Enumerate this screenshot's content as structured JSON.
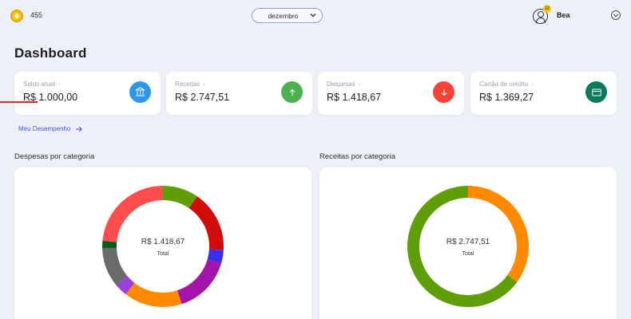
{
  "header": {
    "coins": "455",
    "month": "dezembro",
    "user_badge": "12",
    "user_name": "Bea"
  },
  "page_title": "Dashboard",
  "cards": [
    {
      "label": "Saldo atual",
      "value": "R$ 1.000,00",
      "icon": "bank-icon",
      "color": "#2f96e8"
    },
    {
      "label": "Receitas",
      "value": "R$ 2.747,51",
      "icon": "arrow-up-icon",
      "color": "#4caf50"
    },
    {
      "label": "Despesas",
      "value": "R$ 1.418,67",
      "icon": "arrow-down-icon",
      "color": "#f44336"
    },
    {
      "label": "Cartão de crédito",
      "value": "R$ 1.369,27",
      "icon": "credit-card-icon",
      "color": "#0b7a5c"
    }
  ],
  "performance_link": "Meu Desempenho",
  "expenses_chart": {
    "title": "Despesas por categoria",
    "total": "R$ 1.418,67",
    "total_label": "Total",
    "chart_data": {
      "type": "pie",
      "slices": [
        {
          "value": 9.5,
          "color": "#5f9e09"
        },
        {
          "value": 16.5,
          "color": "#d10a0a"
        },
        {
          "value": 3.5,
          "color": "#3a2ef0"
        },
        {
          "value": 15.5,
          "color": "#a215a8"
        },
        {
          "value": 15.5,
          "color": "#ff8a00"
        },
        {
          "value": 3.5,
          "color": "#9b40d8"
        },
        {
          "value": 10.5,
          "color": "#6a6a6a"
        },
        {
          "value": 2.0,
          "color": "#0d5a1b"
        },
        {
          "value": 23.5,
          "color": "#ff4d4d"
        }
      ]
    }
  },
  "income_chart": {
    "title": "Receitas por categoria",
    "total": "R$ 2.747,51",
    "total_label": "Total",
    "chart_data": {
      "type": "pie",
      "slices": [
        {
          "value": 35,
          "color": "#ff8a00"
        },
        {
          "value": 65,
          "color": "#5f9e09"
        }
      ]
    }
  }
}
